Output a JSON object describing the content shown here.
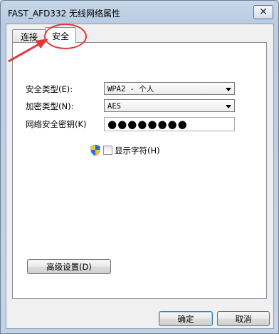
{
  "window": {
    "title": "FAST_AFD332 无线网络属性",
    "close_glyph": "✕"
  },
  "tabs": [
    {
      "label": "连接"
    },
    {
      "label": "安全"
    }
  ],
  "form": {
    "security_type_label": "安全类型(E):",
    "security_type_value": "WPA2 - 个人",
    "encryption_type_label": "加密类型(N):",
    "encryption_type_value": "AES",
    "key_label": "网络安全密钥(K)",
    "key_value": "●●●●●●●●",
    "show_chars_label": "显示字符(H)"
  },
  "buttons": {
    "advanced": "高级设置(D)",
    "ok": "确定",
    "cancel": "取消"
  },
  "colors": {
    "annotation": "#e23636"
  }
}
